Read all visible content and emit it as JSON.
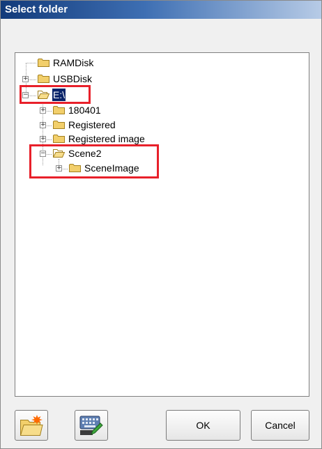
{
  "window": {
    "title": "Select folder"
  },
  "tree": {
    "nodes": [
      {
        "label": "RAMDisk"
      },
      {
        "label": "USBDisk",
        "expander": "+"
      },
      {
        "label": "E:\\",
        "expander": "−",
        "selected": true
      },
      {
        "label": "180401",
        "expander": "+"
      },
      {
        "label": "Registered",
        "expander": "+"
      },
      {
        "label": "Registered image",
        "expander": "+"
      },
      {
        "label": "Scene2",
        "expander": "−"
      },
      {
        "label": "SceneImage",
        "expander": "+"
      }
    ]
  },
  "buttons": {
    "new_folder_icon": "new-folder-icon",
    "keyboard_icon": "keyboard-edit-icon",
    "ok_label": "OK",
    "cancel_label": "Cancel"
  },
  "colors": {
    "highlight": "#e8202a",
    "selection": "#0a246a",
    "folder": "#f2cf6b"
  }
}
